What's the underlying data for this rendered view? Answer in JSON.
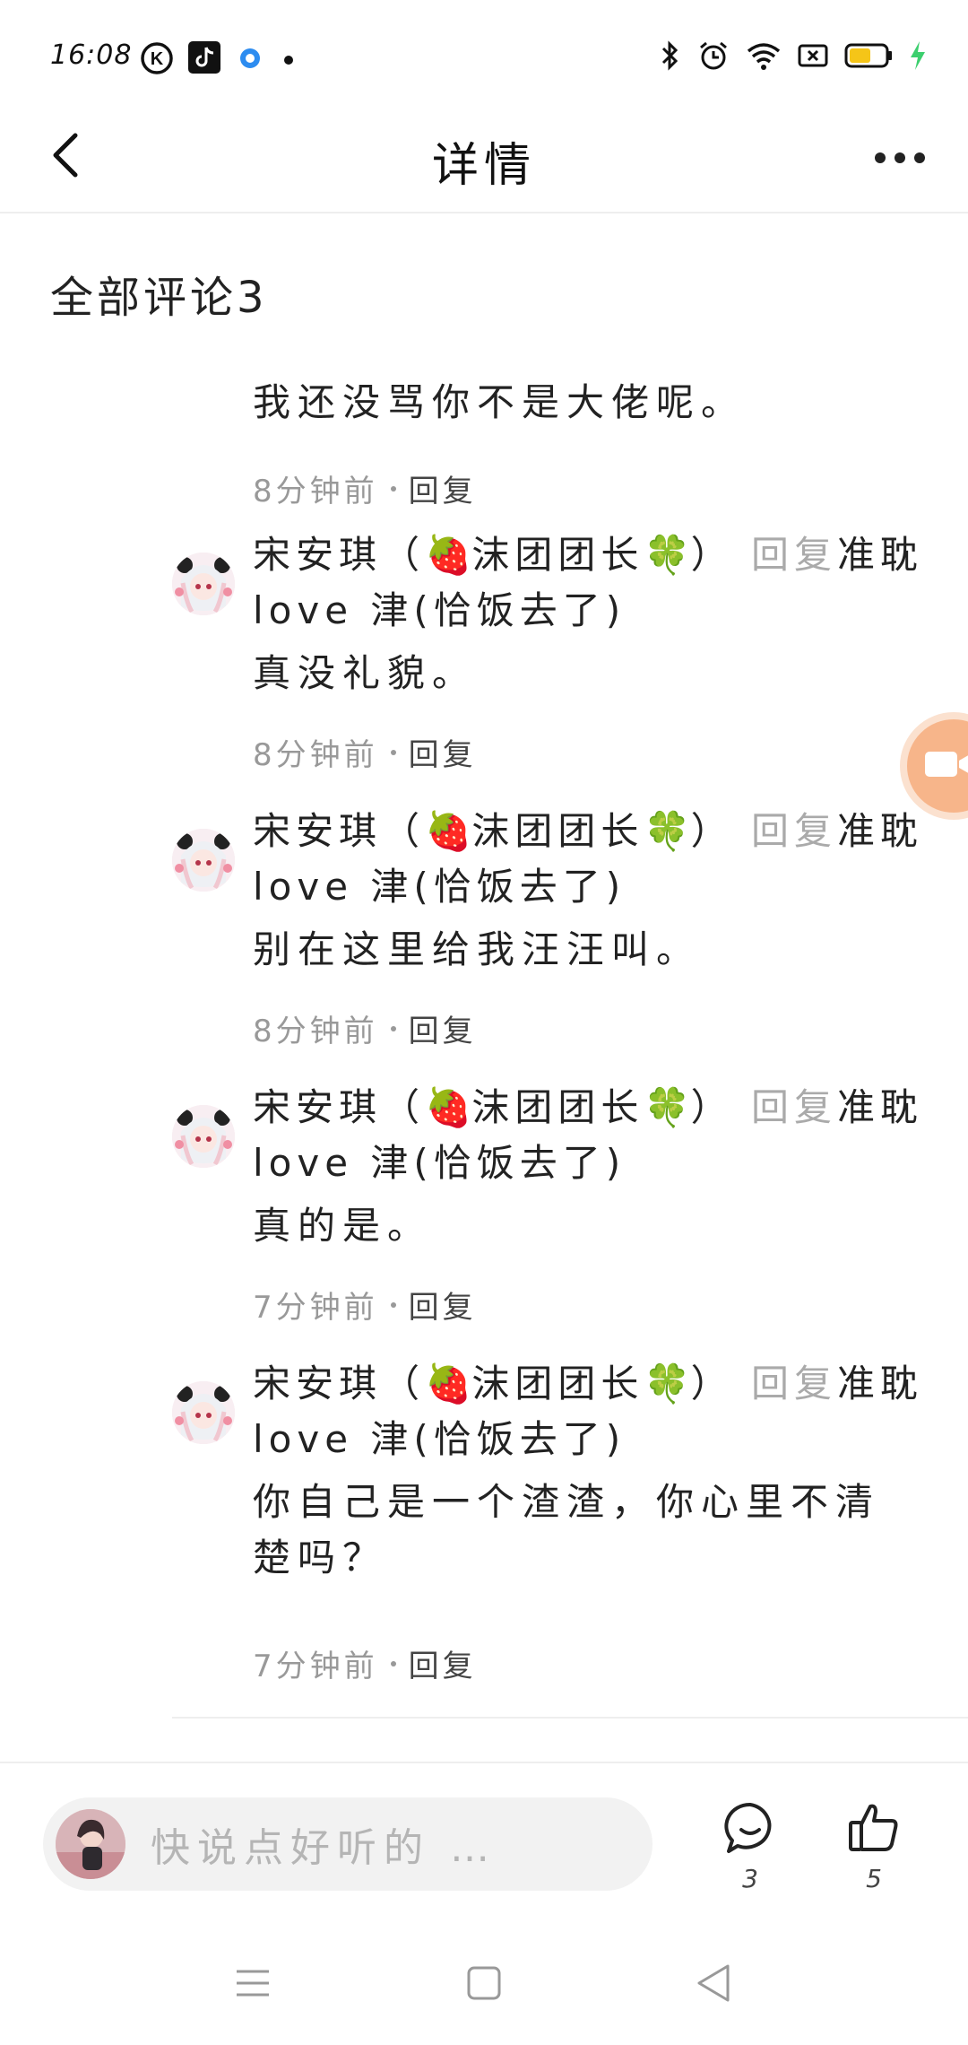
{
  "status_bar": {
    "time": "16:08",
    "left_icons": [
      "k-circle-icon",
      "tiktok-icon",
      "blue-ring-icon",
      "dot-icon"
    ],
    "right_icons": [
      "bluetooth-icon",
      "alarm-icon",
      "wifi-icon",
      "sim-off-icon",
      "battery-icon",
      "charging-icon"
    ],
    "battery_level": 0.6,
    "battery_color": "#f5c518",
    "charging_color": "#3ccf6e"
  },
  "header": {
    "title": "详情",
    "back_icon": "chevron-left-icon",
    "more_icon": "more-dots-icon"
  },
  "comments_section": {
    "title": "全部评论3",
    "top_reply": {
      "text": "我还没骂你不是大佬呢。",
      "time": "8分钟前",
      "reply_label": "回复"
    },
    "replies": [
      {
        "author": "宋安琪（",
        "author_mid": "沫团团长",
        "author_end": "）",
        "reply_word": "回复",
        "target_a": "准耽",
        "target_b": "love 津(恰饭去了)",
        "text": "真没礼貌。",
        "time": "8分钟前",
        "reply_label": "回复"
      },
      {
        "author": "宋安琪（",
        "author_mid": "沫团团长",
        "author_end": "）",
        "reply_word": "回复",
        "target_a": "准耽",
        "target_b": "love 津(恰饭去了)",
        "text": "别在这里给我汪汪叫。",
        "time": "8分钟前",
        "reply_label": "回复"
      },
      {
        "author": "宋安琪（",
        "author_mid": "沫团团长",
        "author_end": "）",
        "reply_word": "回复",
        "target_a": "准耽",
        "target_b": "love 津(恰饭去了)",
        "text": "真的是。",
        "time": "7分钟前",
        "reply_label": "回复"
      },
      {
        "author": "宋安琪（",
        "author_mid": "沫团团长",
        "author_end": "）",
        "reply_word": "回复",
        "target_a": "准耽",
        "target_b": "love 津(恰饭去了)",
        "text": "你自己是一个渣渣，你心里不清楚吗？",
        "time": "7分钟前",
        "reply_label": "回复"
      }
    ],
    "emoji_strawberry": "🍓",
    "emoji_clover": "🍀"
  },
  "floating_button": {
    "icon": "video-camera-icon",
    "color": "#f7b58a"
  },
  "bottom_bar": {
    "input_placeholder": "快说点好听的 …",
    "comment_icon": "comment-bubble-icon",
    "comment_count": "3",
    "like_icon": "thumbs-up-icon",
    "like_count": "5"
  },
  "nav_bar": {
    "menu_icon": "menu-lines-icon",
    "home_icon": "square-home-icon",
    "back_icon": "triangle-back-icon"
  }
}
